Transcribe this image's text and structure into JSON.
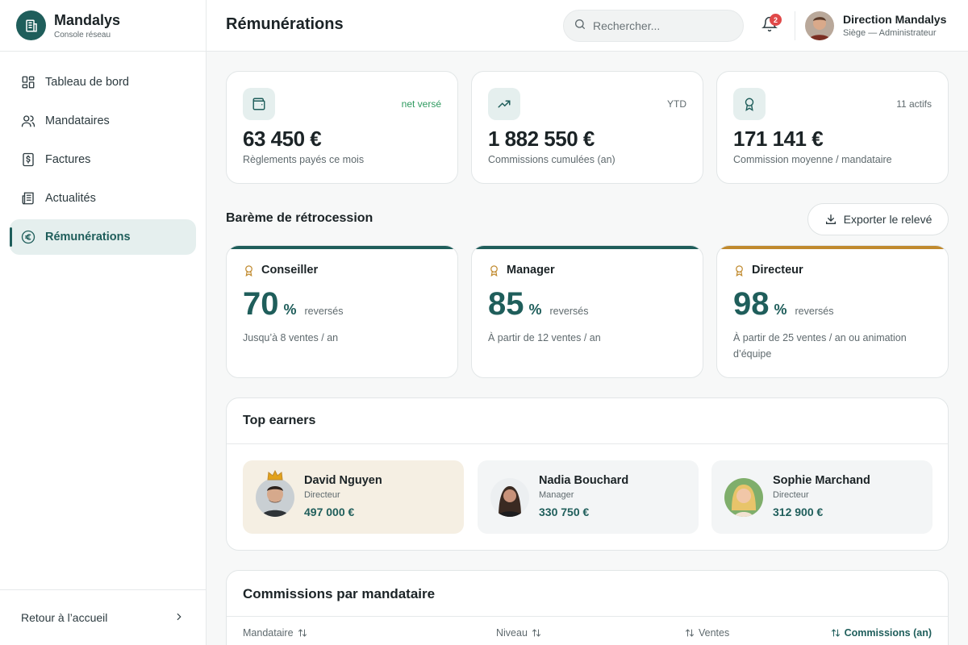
{
  "brand": {
    "name": "Mandalys",
    "subtitle": "Console réseau"
  },
  "sidebar": {
    "items": [
      {
        "label": "Tableau de bord",
        "icon": "dashboard-grid-icon"
      },
      {
        "label": "Mandataires",
        "icon": "users-icon"
      },
      {
        "label": "Factures",
        "icon": "invoice-dollar-icon"
      },
      {
        "label": "Actualités",
        "icon": "newspaper-icon"
      },
      {
        "label": "Rémunérations",
        "icon": "euro-icon",
        "active": true
      }
    ],
    "footer_label": "Retour à l’accueil"
  },
  "header": {
    "title": "Rémunérations",
    "search_placeholder": "Rechercher...",
    "notifications_count": "2",
    "user_name": "Direction Mandalys",
    "user_role": "Siège — Administrateur"
  },
  "stats": [
    {
      "tag": "net versé",
      "value": "63 450 €",
      "label": "Règlements payés ce mois",
      "icon": "wallet-icon"
    },
    {
      "tag": "YTD",
      "value": "1 882 550 €",
      "label": "Commissions cumulées (an)",
      "icon": "trending-up-icon"
    },
    {
      "tag": "11 actifs",
      "value": "171 141 €",
      "label": "Commission moyenne / mandataire",
      "icon": "award-icon"
    }
  ],
  "bareme": {
    "title": "Barème de rétrocession",
    "export_label": "Exporter le relevé",
    "tiers": [
      {
        "name": "Conseiller",
        "rate": "70",
        "pct": "%",
        "suffix": "reversés",
        "desc": "Jusqu’à 8 ventes / an",
        "bar_color": "#1f5e5b"
      },
      {
        "name": "Manager",
        "rate": "85",
        "pct": "%",
        "suffix": "reversés",
        "desc": "À partir de 12 ventes / an",
        "bar_color": "#1f5e5b"
      },
      {
        "name": "Directeur",
        "rate": "98",
        "pct": "%",
        "suffix": "reversés",
        "desc": "À partir de 25 ventes / an ou animation d’équipe",
        "bar_color": "#c08a2e"
      }
    ]
  },
  "top_earners": {
    "title": "Top earners",
    "people": [
      {
        "name": "David Nguyen",
        "role": "Directeur",
        "amount": "497 000 €"
      },
      {
        "name": "Nadia Bouchard",
        "role": "Manager",
        "amount": "330 750 €"
      },
      {
        "name": "Sophie Marchand",
        "role": "Directeur",
        "amount": "312 900 €"
      }
    ]
  },
  "commissions_table": {
    "title": "Commissions par mandataire",
    "columns": [
      "Mandataire",
      "Niveau",
      "Ventes",
      "Commissions (an)"
    ]
  },
  "colors": {
    "primary": "#1f5e5b",
    "gold": "#c08a2e",
    "success": "#2e9a5f",
    "alert": "#e04848"
  }
}
